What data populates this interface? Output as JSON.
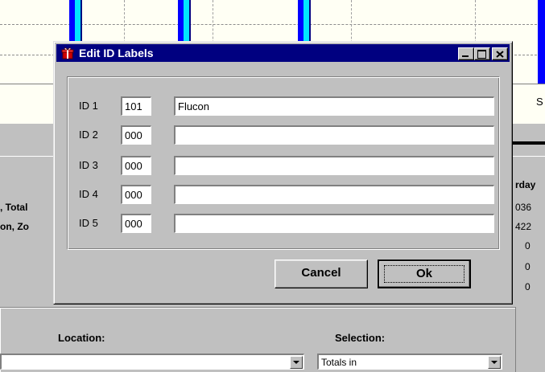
{
  "background": {
    "right_column_labels": {
      "top_label": "S",
      "weekday": "rday",
      "values": [
        "036",
        "422",
        "0",
        "0",
        "0"
      ]
    },
    "left_labels": [
      ", Total",
      "on, Zo"
    ],
    "location_label": "Location:",
    "selection_label": "Selection:",
    "selection_value": "Totals in"
  },
  "dialog": {
    "title": "Edit ID Labels",
    "title_icon": "gift-box-icon",
    "rows": [
      {
        "label": "ID 1",
        "number": "101",
        "text": "Flucon"
      },
      {
        "label": "ID 2",
        "number": "000",
        "text": ""
      },
      {
        "label": "ID 3",
        "number": "000",
        "text": ""
      },
      {
        "label": "ID 4",
        "number": "000",
        "text": ""
      },
      {
        "label": "ID 5",
        "number": "000",
        "text": ""
      }
    ],
    "cancel_label": "Cancel",
    "ok_label": "Ok"
  },
  "colors": {
    "title_bar": "#000080",
    "face": "#c0c0c0",
    "chart_bg": "#fffff4",
    "bar_blue": "#0000ff",
    "bar_cyan": "#00e5ff"
  }
}
